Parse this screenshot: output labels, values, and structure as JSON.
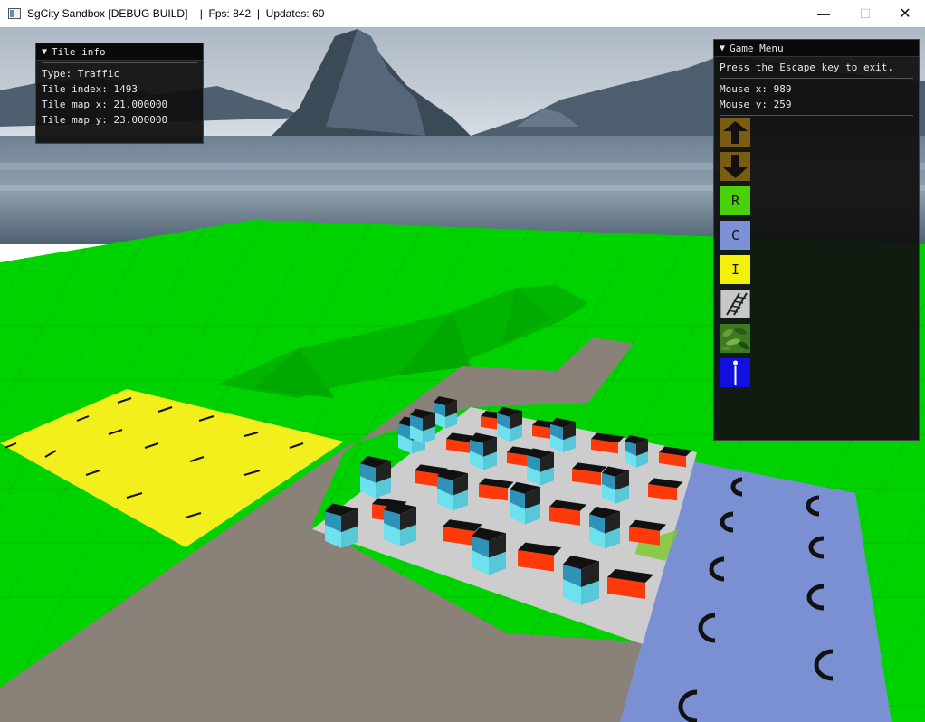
{
  "window": {
    "title": "SgCity Sandbox [DEBUG BUILD]    |  Fps: 842  |  Updates: 60",
    "minimize_glyph": "—",
    "maximize_glyph": "☐",
    "close_glyph": "✕"
  },
  "tile_info": {
    "title": "Tile info",
    "type_line": "Type: Traffic",
    "index_line": "Tile index: 1493",
    "map_x_line": "Tile map x: 21.000000",
    "map_y_line": "Tile map y: 23.000000"
  },
  "game_menu": {
    "title": "Game Menu",
    "hint": "Press the Escape key to exit.",
    "mouse_x_line": "Mouse x: 989",
    "mouse_y_line": "Mouse y: 259",
    "tools": [
      {
        "id": "raise",
        "label": "",
        "icon": "arrow-up-icon",
        "color": "#7a5c12"
      },
      {
        "id": "lower",
        "label": "",
        "icon": "arrow-down-icon",
        "color": "#7a5c12"
      },
      {
        "id": "residential",
        "label": "R",
        "icon": "",
        "color": "#4ad10a"
      },
      {
        "id": "commercial",
        "label": "C",
        "icon": "",
        "color": "#7b90d6"
      },
      {
        "id": "industrial",
        "label": "I",
        "icon": "",
        "color": "#f3f10c"
      },
      {
        "id": "traffic",
        "label": "",
        "icon": "railroad-icon",
        "color": "#c8c8c8"
      },
      {
        "id": "plants",
        "label": "",
        "icon": "plants-icon",
        "color": "#3b7a1e"
      },
      {
        "id": "info",
        "label": "",
        "icon": "info-icon",
        "color": "#1010e0"
      }
    ]
  },
  "colors": {
    "grass": "#00d400",
    "residential": "#f2ef1a",
    "commercial": "#7a8fd0",
    "road": "#8a8279",
    "zone_base": "#cccccc",
    "building_side": "#6ee1ef",
    "roof": "#111111",
    "orange_block": "#ff3a0a"
  }
}
